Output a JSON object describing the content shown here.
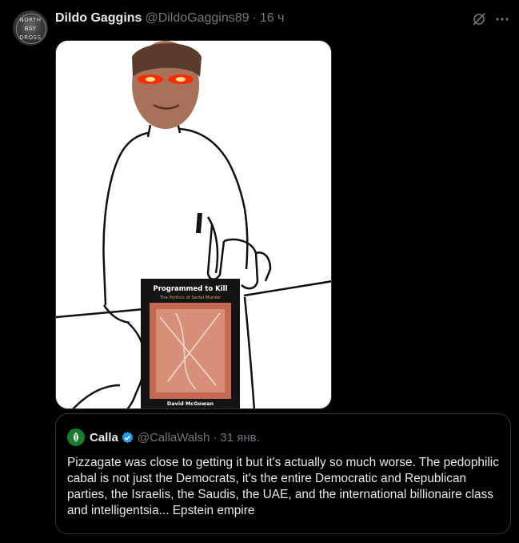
{
  "post": {
    "author_name": "Dildo Gaggins",
    "author_handle": "@DildoGaggins89",
    "separator": "·",
    "time": "16 ч",
    "avatar_text": [
      "NORTH",
      "BAY",
      "DROSS"
    ],
    "icons": [
      "grok-icon",
      "more-icon"
    ]
  },
  "media": {
    "book_title": "Programmed to Kill",
    "book_subtitle": "The Politics of Serial Murder",
    "book_author": "David McGowan"
  },
  "quote": {
    "author_name": "Calla",
    "author_handle": "@CallaWalsh",
    "separator": "·",
    "time": "31 янв.",
    "text": "Pizzagate was close to getting it but it's actually so much worse. The pedophilic cabal is not just the Democrats, it's the entire Democratic and Republican parties, the Israelis, the Saudis, the UAE, and the international billionaire class and intelligentsia... Epstein empire",
    "verified_color": "#1d9bf0"
  }
}
